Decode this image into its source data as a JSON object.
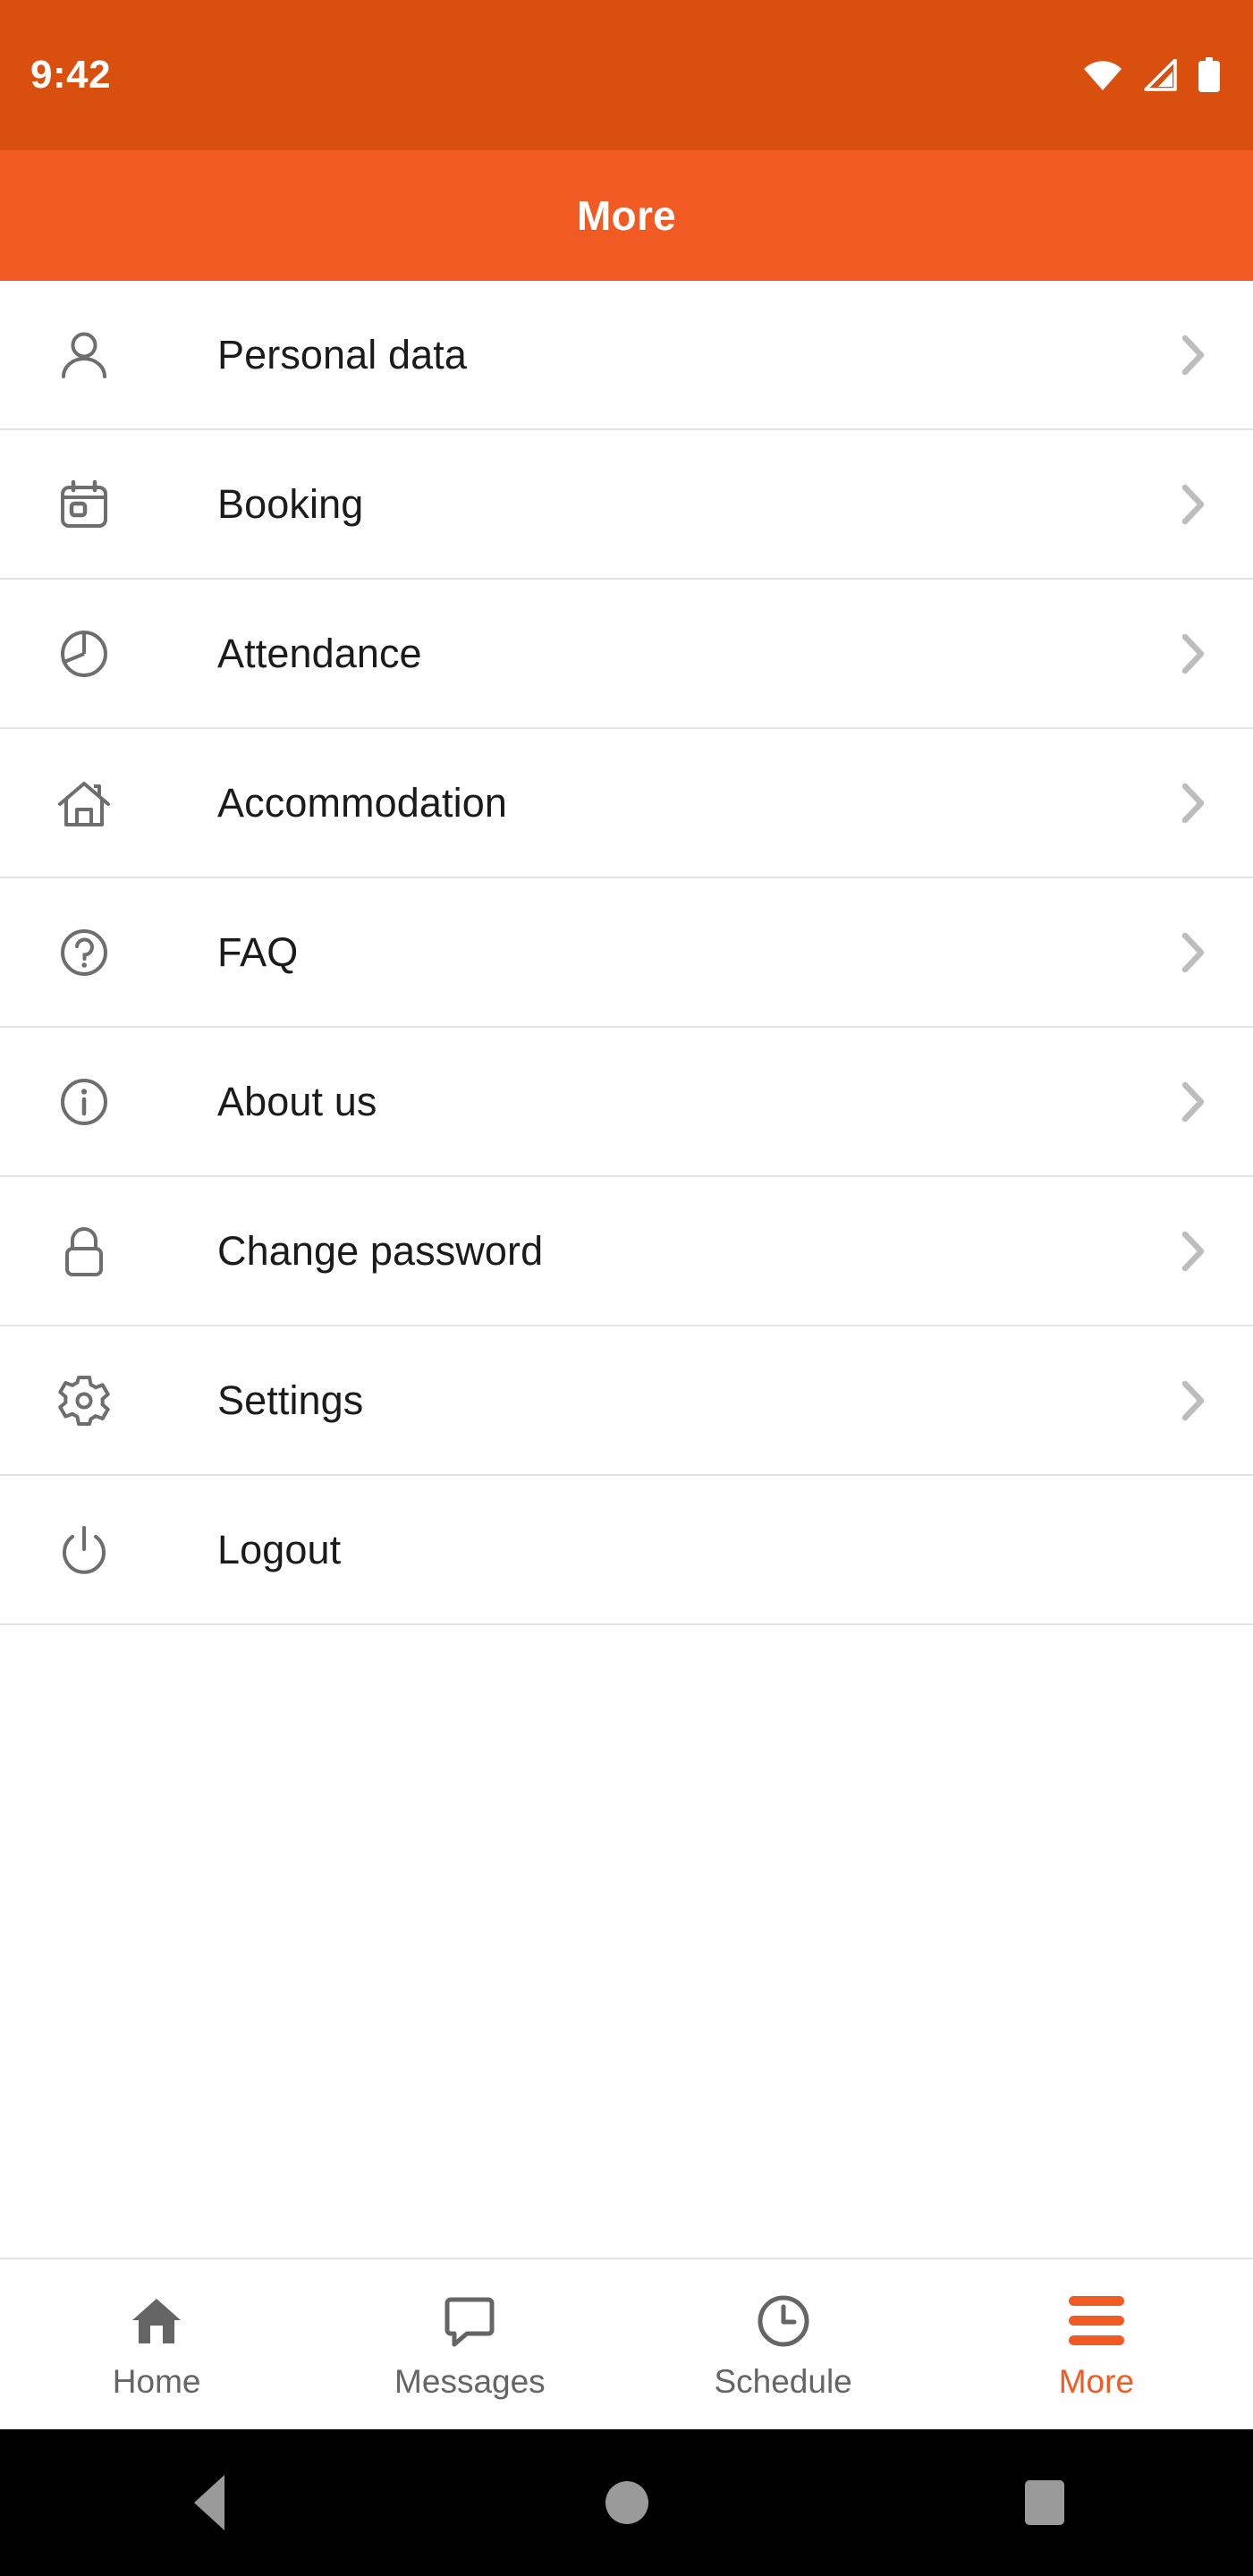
{
  "status_bar": {
    "time": "9:42",
    "icons": [
      "wifi-icon",
      "cellular-signal-icon",
      "battery-icon"
    ],
    "background_color": "#d9500e",
    "text_color": "#ffffff"
  },
  "header": {
    "title": "More",
    "background_color": "#f15a22",
    "text_color": "#ffffff"
  },
  "menu": {
    "items": [
      {
        "label": "Personal data",
        "icon": "person-icon",
        "chevron": "chevron-right-icon"
      },
      {
        "label": "Booking",
        "icon": "calendar-icon",
        "chevron": "chevron-right-icon"
      },
      {
        "label": "Attendance",
        "icon": "pie-chart-icon",
        "chevron": "chevron-right-icon"
      },
      {
        "label": "Accommodation",
        "icon": "house-icon",
        "chevron": "chevron-right-icon"
      },
      {
        "label": "FAQ",
        "icon": "question-mark-circle-icon",
        "chevron": "chevron-right-icon"
      },
      {
        "label": "About us",
        "icon": "info-circle-icon",
        "chevron": "chevron-right-icon"
      },
      {
        "label": "Change password",
        "icon": "lock-icon",
        "chevron": "chevron-right-icon"
      },
      {
        "label": "Settings",
        "icon": "gear-icon",
        "chevron": "chevron-right-icon"
      },
      {
        "label": "Logout",
        "icon": "power-icon",
        "chevron": ""
      }
    ],
    "icon_color": "#6e6e6e",
    "label_color": "#1b1b1b",
    "divider_color": "#e3e3e3"
  },
  "tab_bar": {
    "items": [
      {
        "label": "Home",
        "icon": "home-filled-icon",
        "active": false
      },
      {
        "label": "Messages",
        "icon": "speech-bubble-icon",
        "active": false
      },
      {
        "label": "Schedule",
        "icon": "clock-icon",
        "active": false
      },
      {
        "label": "More",
        "icon": "hamburger-menu-icon",
        "active": true
      }
    ],
    "inactive_color": "#656565",
    "active_color": "#f15a22"
  },
  "android_nav": {
    "buttons": [
      "back-button",
      "home-button",
      "recents-button"
    ],
    "background_color": "#000000",
    "icon_color": "#9a9a9a"
  }
}
